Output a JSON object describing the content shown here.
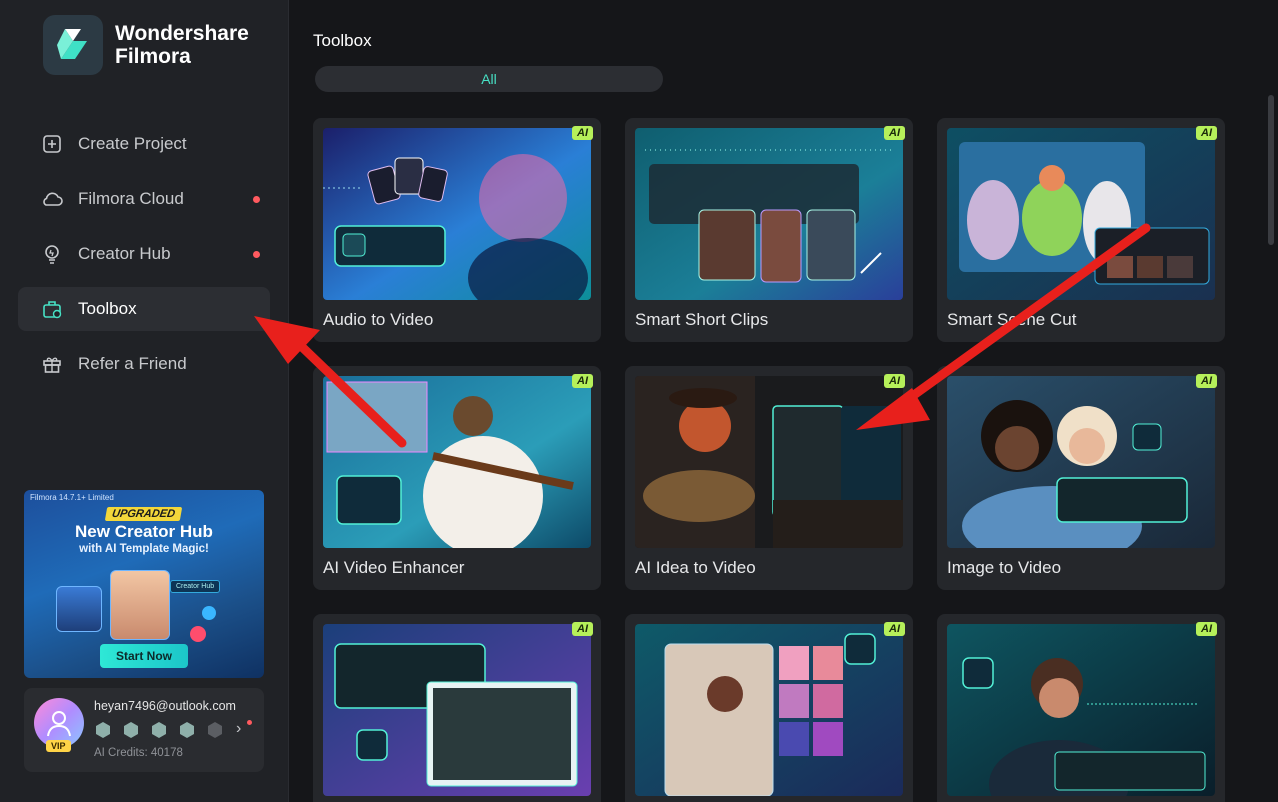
{
  "brand": {
    "line1": "Wondershare",
    "line2": "Filmora"
  },
  "nav": [
    {
      "label": "Create Project",
      "icon": "plus-square-icon",
      "active": false,
      "dot": false
    },
    {
      "label": "Filmora Cloud",
      "icon": "cloud-icon",
      "active": false,
      "dot": true
    },
    {
      "label": "Creator Hub",
      "icon": "bulb-icon",
      "active": false,
      "dot": true
    },
    {
      "label": "Toolbox",
      "icon": "toolbox-icon",
      "active": true,
      "dot": false
    },
    {
      "label": "Refer a Friend",
      "icon": "gift-icon",
      "active": false,
      "dot": false
    }
  ],
  "promo": {
    "version": "Filmora 14.7.1+ Limited",
    "tag": "UPGRADED",
    "headline": "New Creator Hub",
    "subline": "with AI Template Magic!",
    "chip": "Creator Hub",
    "cta": "Start Now"
  },
  "account": {
    "email": "heyan7496@outlook.com",
    "vip": "VIP",
    "credits": "AI Credits: 40178"
  },
  "main": {
    "title": "Toolbox",
    "tab": "All"
  },
  "tools": [
    {
      "label": "Audio to Video",
      "ai": "AI"
    },
    {
      "label": "Smart Short Clips",
      "ai": "AI"
    },
    {
      "label": "Smart Scene Cut",
      "ai": "AI"
    },
    {
      "label": "AI Video Enhancer",
      "ai": "AI"
    },
    {
      "label": "AI Idea to Video",
      "ai": "AI"
    },
    {
      "label": "Image to Video",
      "ai": "AI"
    },
    {
      "label": "",
      "ai": "AI"
    },
    {
      "label": "",
      "ai": "AI"
    },
    {
      "label": "",
      "ai": "AI"
    }
  ],
  "colors": {
    "accent": "#47e1c5",
    "ai_badge": "#b6f05a",
    "arrow": "#e8201c",
    "notification": "#ff5a5f"
  }
}
